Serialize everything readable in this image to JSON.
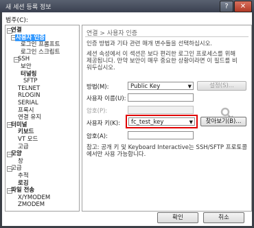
{
  "window": {
    "title": "새 세션 등록 정보",
    "help_label": "?",
    "close_label": "✕"
  },
  "category_label": "범주(C):",
  "tree": [
    {
      "label": "연결",
      "bold": true,
      "expander": "−"
    },
    {
      "label": "사용자 인증",
      "bold": true,
      "expander": "−"
    },
    {
      "label": "로그인 프롬프트"
    },
    {
      "label": "로그인 스크립트"
    },
    {
      "label": "SSH",
      "expander": "−"
    },
    {
      "label": "보안"
    },
    {
      "label": "터널링",
      "bold": true
    },
    {
      "label": "SFTP"
    },
    {
      "label": "TELNET"
    },
    {
      "label": "RLOGIN"
    },
    {
      "label": "SERIAL"
    },
    {
      "label": "프록시"
    },
    {
      "label": "연결 유지"
    },
    {
      "label": "터미널",
      "bold": true,
      "expander": "−"
    },
    {
      "label": "키보드",
      "bold": true
    },
    {
      "label": "VT 모드"
    },
    {
      "label": "고급"
    },
    {
      "label": "모양",
      "bold": true,
      "expander": "−"
    },
    {
      "label": "창"
    },
    {
      "label": "고급",
      "expander": "−"
    },
    {
      "label": "추적"
    },
    {
      "label": "로깅",
      "bold": true
    },
    {
      "label": "파일 전송",
      "bold": true,
      "expander": "−"
    },
    {
      "label": "X/YMODEM"
    },
    {
      "label": "ZMODEM"
    }
  ],
  "panel": {
    "breadcrumb": "연결 > 사용자 인증",
    "description1": "인증 방법과 기타 관련 매개 변수들을 선택하십시오.",
    "description2_lines": [
      "세션 속성에서 이 섹션은 보다 편리한 로그인 프로세스를 위해",
      "제공됩니다. 만약 보안이 매우 중요한 상황이라면 이 필드를 비",
      "워두십시오."
    ],
    "method_label": "방법(M):",
    "method_value": "Public Key",
    "settings_button": "설정(S)...",
    "username_label": "사용자 이름(U):",
    "password_label": "암호(P):",
    "user_key_label": "사용자 키(K):",
    "user_key_value": "fc_test_key",
    "browse_button": "찾아보기(B)...",
    "passphrase_label": "암호(A):",
    "note_lines": [
      "참고: 공개 키 및 Keyboard Interactive는 SSH/SFTP 프로토콜",
      "에서만 사용 가능합니다."
    ]
  },
  "footer": {
    "ok_label": "확인",
    "cancel_label": "취소"
  },
  "colors": {
    "title_bar": "#3a4050",
    "selection": "#3399ff",
    "highlight_box": "#e00000"
  }
}
